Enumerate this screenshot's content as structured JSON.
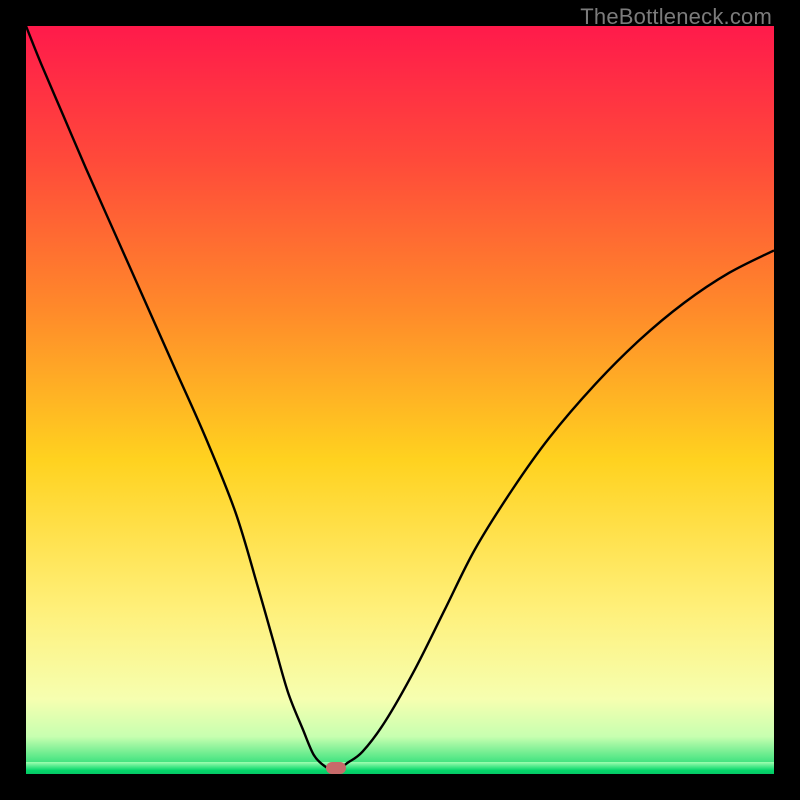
{
  "watermark": "TheBottleneck.com",
  "colors": {
    "frame": "#000000",
    "grad_top": "#ff1a4b",
    "grad_mid1": "#ff7a2a",
    "grad_mid2": "#ffd21f",
    "grad_mid3": "#ffef7a",
    "grad_mid4": "#f6ffa8",
    "grad_bot": "#05d76a",
    "stripe": "#05d76a",
    "curve": "#000000",
    "marker": "#c76a6a"
  },
  "layout": {
    "gradient_css": "linear-gradient(to bottom, #ff1a4b 0%, #ff4a3a 18%, #ff8a2a 38%, #ffd21f 58%, #fff07a 78%, #f6ffb0 90%, #c7ffb0 95%, #05d76a 100%)",
    "stripe_style": "height:12px; background: linear-gradient(to bottom, #9fffb0 0%, #05d76a 70%, #05c766 100%);"
  },
  "chart_data": {
    "type": "line",
    "title": "",
    "xlabel": "",
    "ylabel": "",
    "x_range": [
      0,
      100
    ],
    "y_range": [
      0,
      100
    ],
    "series": [
      {
        "name": "bottleneck-curve",
        "x": [
          0,
          2,
          5,
          8,
          12,
          16,
          20,
          24,
          28,
          31,
          33,
          35,
          37,
          38.5,
          40,
          41,
          42,
          43,
          45,
          48,
          52,
          56,
          60,
          65,
          70,
          76,
          82,
          88,
          94,
          100
        ],
        "values": [
          100,
          95,
          88,
          81,
          72,
          63,
          54,
          45,
          35,
          25,
          18,
          11,
          6,
          2.5,
          1,
          0.6,
          0.8,
          1.5,
          3,
          7,
          14,
          22,
          30,
          38,
          45,
          52,
          58,
          63,
          67,
          70
        ]
      }
    ],
    "marker": {
      "x": 41.5,
      "y": 0.8,
      "color": "#c76a6a"
    },
    "legend": [],
    "grid": false
  }
}
